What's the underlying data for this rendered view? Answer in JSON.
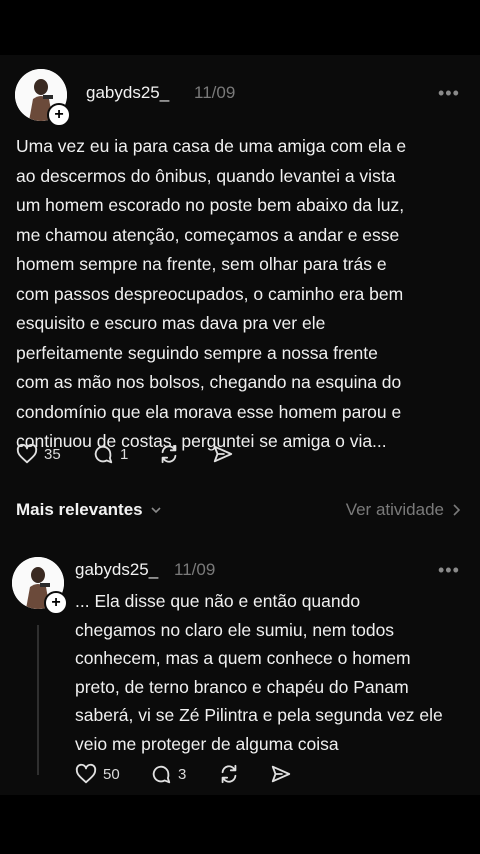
{
  "post": {
    "username": "gabyds25_",
    "date": "11/09",
    "more": "•••",
    "body": "Uma vez eu ia para casa de uma amiga com ela e\nao descermos do ônibus, quando levantei a vista\num homem escorado no poste bem abaixo da luz,\nme chamou atenção, começamos a andar e esse\nhomem sempre na frente, sem olhar para trás e\ncom passos despreocupados, o caminho era bem\nesquisito e escuro mas dava pra ver ele\nperfeitamente seguindo sempre a nossa frente\ncom as mão nos bolsos, chegando na esquina do\ncondomínio que ela morava esse homem parou e\ncontinuou de costas, perguntei se amiga o via...",
    "likes": "35",
    "replies": "1"
  },
  "section": {
    "title": "Mais relevantes",
    "link": "Ver atividade"
  },
  "reply": {
    "username": "gabyds25_",
    "date": "11/09",
    "more": "•••",
    "body": "... Ela disse que não e então quando\nchegamos no claro ele sumiu, nem todos\nconhecem, mas a quem conhece o homem\npreto, de terno branco e chapéu do Panam\nsaberá, vi se Zé Pilintra e pela segunda vez ele\nveio me proteger de alguma coisa",
    "likes": "50",
    "replies": "3"
  },
  "icons": {
    "plus": "+",
    "like": "heart-icon",
    "reply": "comment-icon",
    "repost": "repost-icon",
    "share": "send-icon"
  }
}
